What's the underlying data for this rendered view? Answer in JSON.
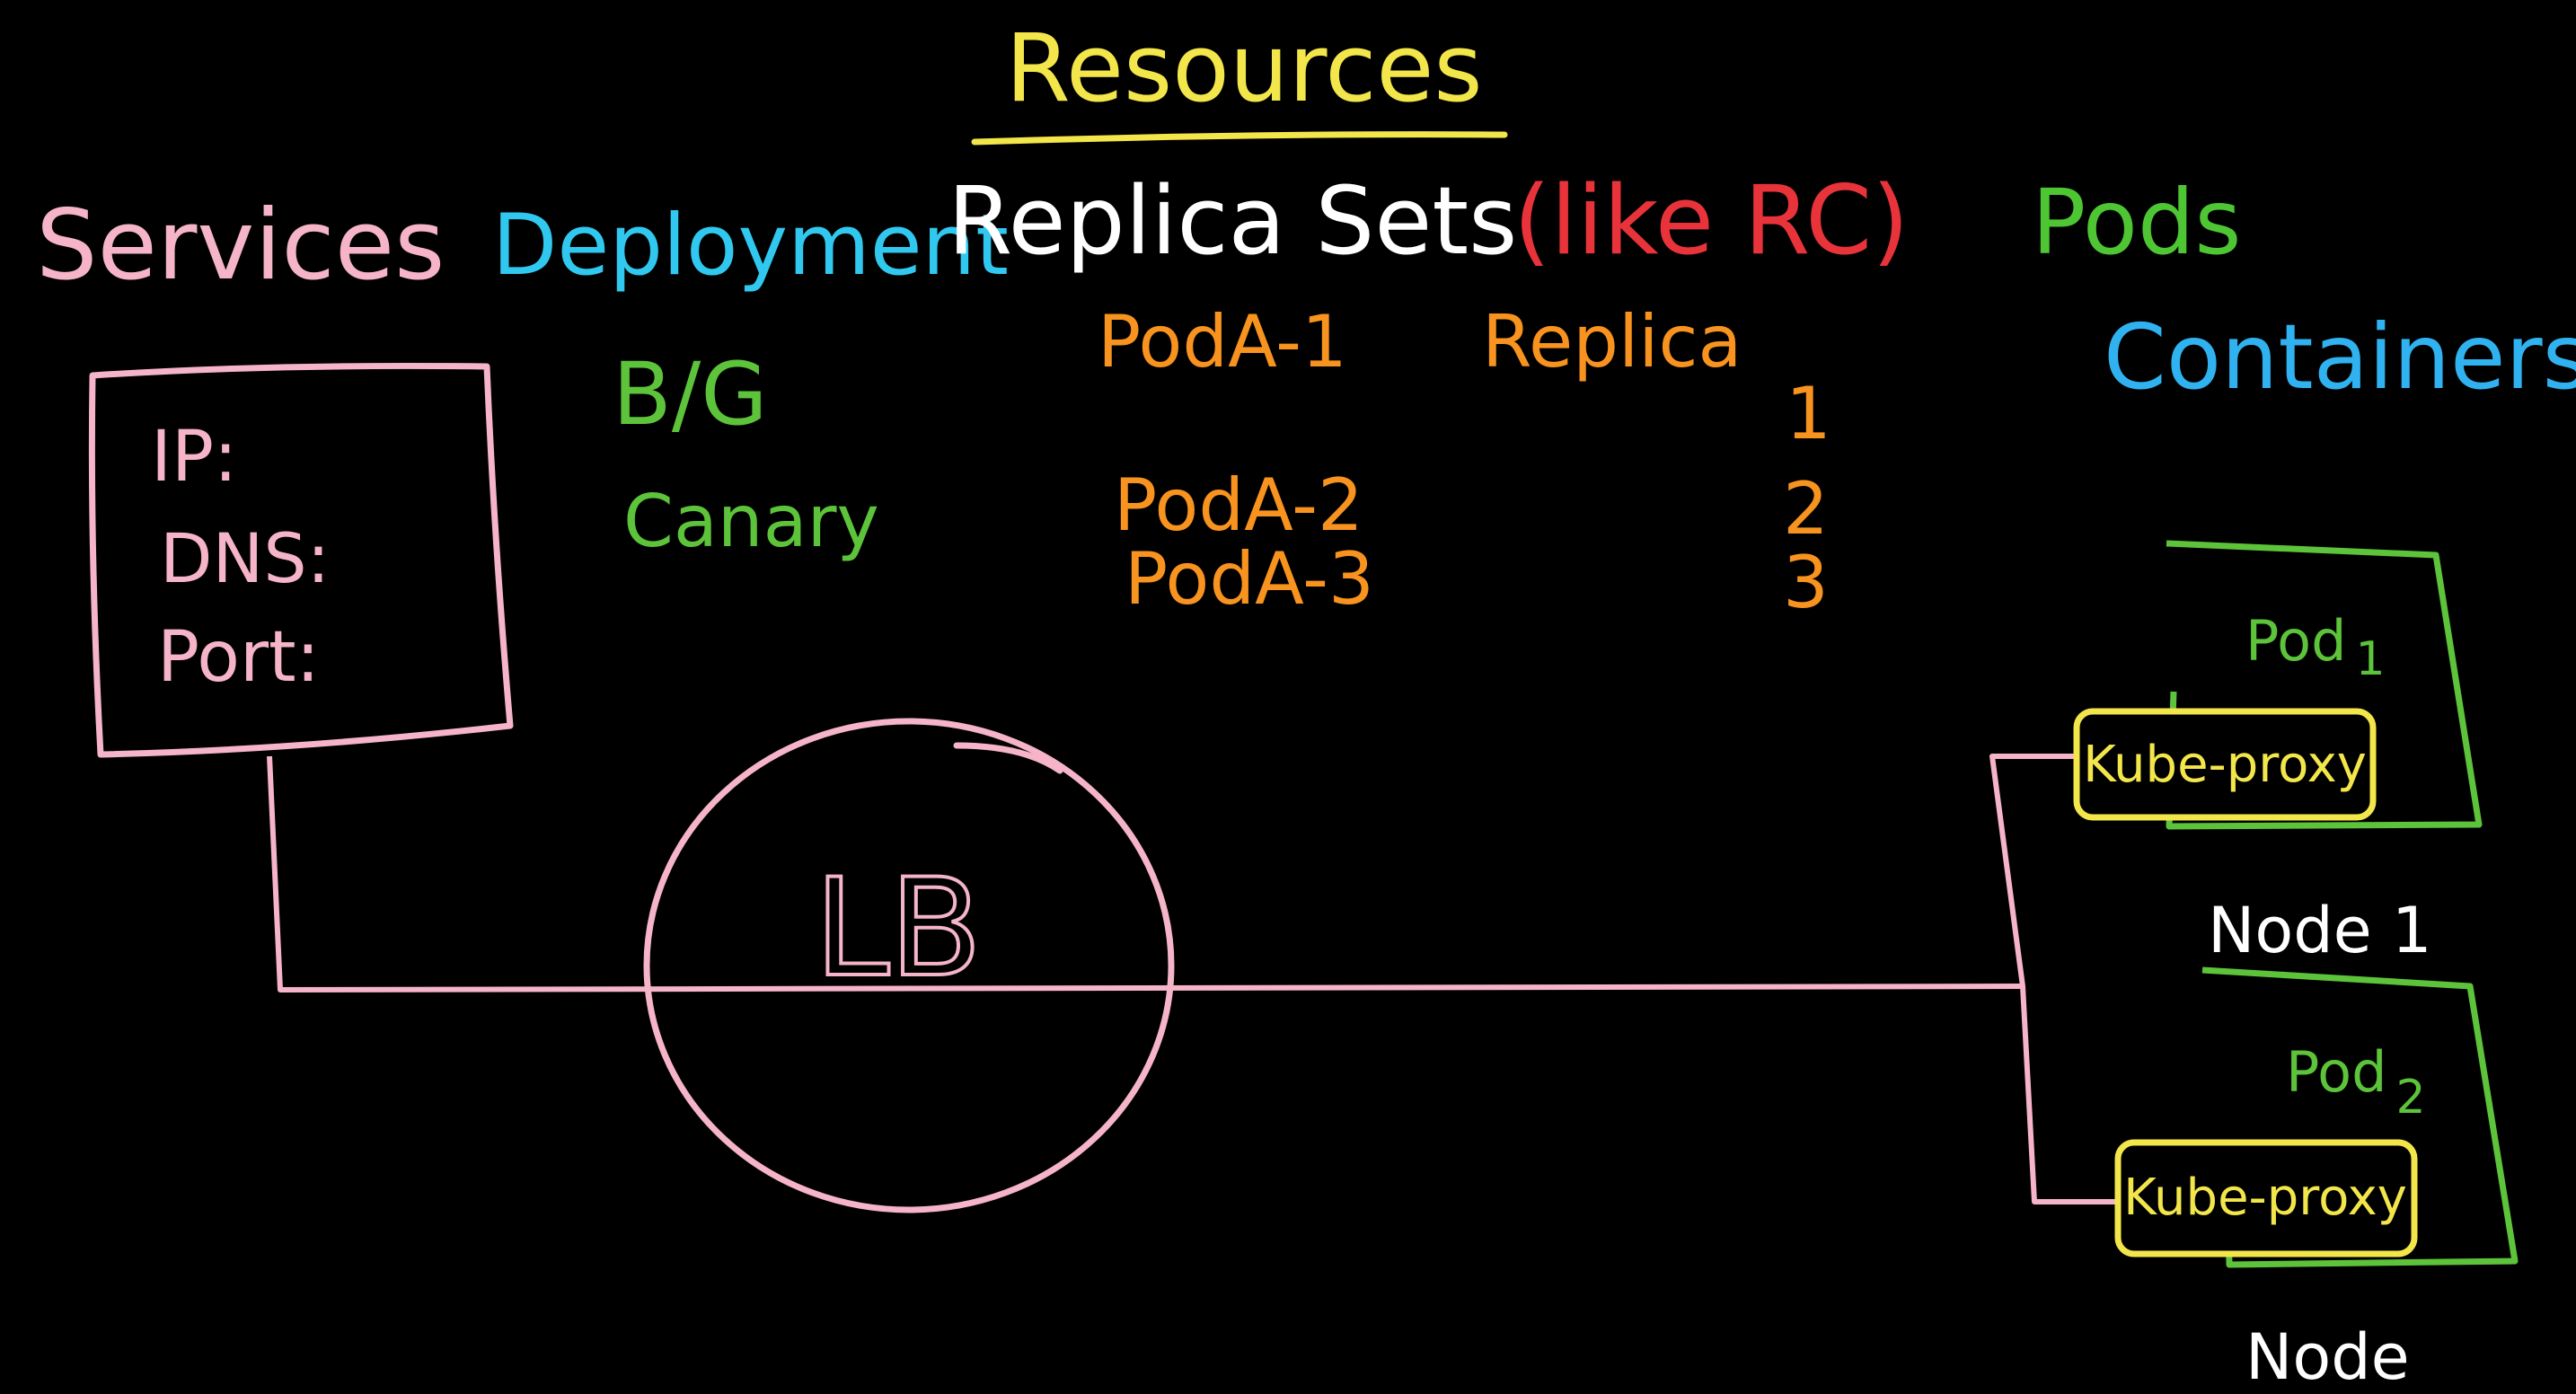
{
  "title": "Resources",
  "headings": {
    "services": "Services",
    "deployment": "Deployment",
    "replica_sets": "Replica Sets",
    "like_rc": "(like RC)",
    "pods": "Pods",
    "containers": "Containers"
  },
  "deployment_strategies": [
    "B/G",
    "Canary"
  ],
  "pods_list": [
    "PodA-1",
    "PodA-2",
    "PodA-3"
  ],
  "replica_label": "Replica",
  "replica_numbers": [
    "1",
    "2",
    "3"
  ],
  "service_box": {
    "ip": "IP:",
    "dns": "DNS:",
    "port": "Port:"
  },
  "load_balancer": "LB",
  "nodes": [
    {
      "pod": "Pod",
      "pod_sub": "1",
      "proxy": "Kube-proxy",
      "node_label": "Node 1"
    },
    {
      "pod": "Pod",
      "pod_sub": "2",
      "proxy": "Kube-proxy",
      "node_label": "Node"
    }
  ],
  "colors": {
    "background": "#000000",
    "title": "#f2e64a",
    "services": "#f5b4c8",
    "deployment": "#31c8f0",
    "replica_sets": "#ffffff",
    "like_rc": "#e8333a",
    "pods": "#4ec634",
    "containers": "#31b2f0",
    "orange": "#f7931e",
    "green": "#5cc33a",
    "pink": "#f5b4c8",
    "yellow": "#f2e64a"
  }
}
